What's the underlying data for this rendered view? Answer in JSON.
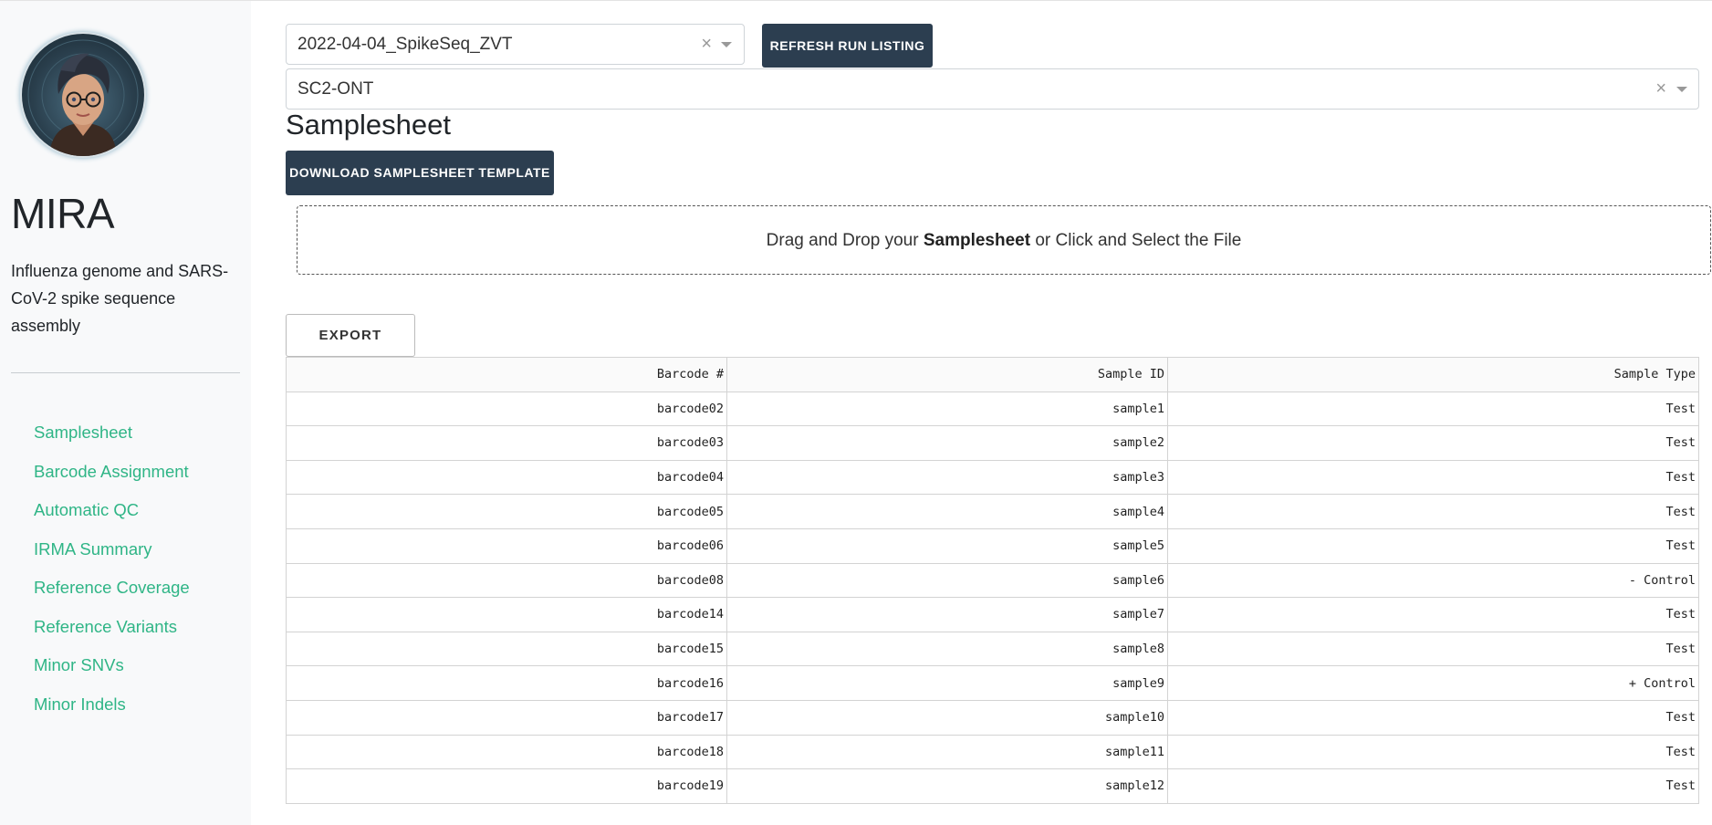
{
  "app": {
    "name": "MIRA",
    "tagline": "Influenza genome and SARS-CoV-2 spike sequence assembly"
  },
  "sidebar": {
    "items": [
      {
        "label": "Samplesheet"
      },
      {
        "label": "Barcode Assignment"
      },
      {
        "label": "Automatic QC"
      },
      {
        "label": "IRMA Summary"
      },
      {
        "label": "Reference Coverage"
      },
      {
        "label": "Reference Variants"
      },
      {
        "label": "Minor SNVs"
      },
      {
        "label": "Minor Indels"
      }
    ],
    "link_color": "#2fb586"
  },
  "controls": {
    "run_select_value": "2022-04-04_SpikeSeq_ZVT",
    "module_select_value": "SC2-ONT",
    "clear_glyph": "×",
    "refresh_label": "REFRESH RUN LISTING",
    "download_label": "DOWNLOAD SAMPLESHEET TEMPLATE",
    "export_label": "EXPORT"
  },
  "samplesheet": {
    "title": "Samplesheet",
    "dropzone": {
      "prefix": "Drag and Drop your ",
      "bold": "Samplesheet",
      "suffix": " or Click and Select the File"
    },
    "columns": [
      "Barcode #",
      "Sample ID",
      "Sample Type"
    ],
    "rows": [
      [
        "barcode02",
        "sample1",
        "Test"
      ],
      [
        "barcode03",
        "sample2",
        "Test"
      ],
      [
        "barcode04",
        "sample3",
        "Test"
      ],
      [
        "barcode05",
        "sample4",
        "Test"
      ],
      [
        "barcode06",
        "sample5",
        "Test"
      ],
      [
        "barcode08",
        "sample6",
        "- Control"
      ],
      [
        "barcode14",
        "sample7",
        "Test"
      ],
      [
        "barcode15",
        "sample8",
        "Test"
      ],
      [
        "barcode16",
        "sample9",
        "+ Control"
      ],
      [
        "barcode17",
        "sample10",
        "Test"
      ],
      [
        "barcode18",
        "sample11",
        "Test"
      ],
      [
        "barcode19",
        "sample12",
        "Test"
      ]
    ]
  },
  "colors": {
    "button_dark": "#2c3e50",
    "sidebar_bg": "#f8f9fa"
  }
}
